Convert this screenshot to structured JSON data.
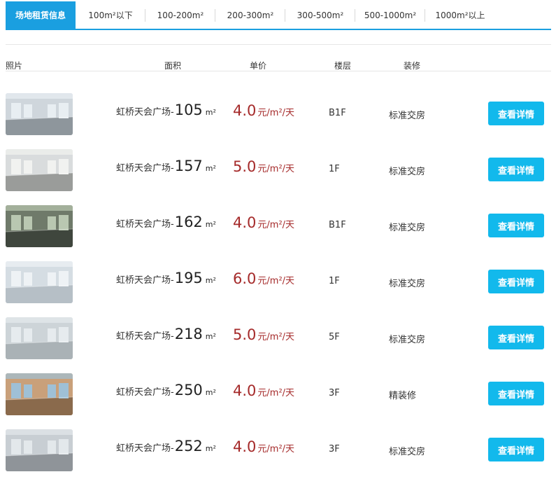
{
  "tabs": [
    {
      "label": "场地租赁信息",
      "active": true
    },
    {
      "label": "100m²以下",
      "active": false
    },
    {
      "label": "100-200m²",
      "active": false
    },
    {
      "label": "200-300m²",
      "active": false
    },
    {
      "label": "300-500m²",
      "active": false
    },
    {
      "label": "500-1000m²",
      "active": false
    },
    {
      "label": "1000m²以上",
      "active": false
    }
  ],
  "table_headers": {
    "photo": "照片",
    "area": "面积",
    "price": "单价",
    "floor": "楼层",
    "decoration": "装修"
  },
  "colors": {
    "accent": "#1a9fe0",
    "button": "#12b9ec",
    "price": "#a52a2a"
  },
  "listings": [
    {
      "location": "虹桥天会广场-",
      "area": "105",
      "area_unit": "m²",
      "price": "4.0",
      "price_unit": "元/m²/天",
      "floor": "B1F",
      "decoration": "标准交房",
      "button": "查看详情"
    },
    {
      "location": "虹桥天会广场-",
      "area": "157",
      "area_unit": "m²",
      "price": "5.0",
      "price_unit": "元/m²/天",
      "floor": "1F",
      "decoration": "标准交房",
      "button": "查看详情"
    },
    {
      "location": "虹桥天会广场-",
      "area": "162",
      "area_unit": "m²",
      "price": "4.0",
      "price_unit": "元/m²/天",
      "floor": "B1F",
      "decoration": "标准交房",
      "button": "查看详情"
    },
    {
      "location": "虹桥天会广场-",
      "area": "195",
      "area_unit": "m²",
      "price": "6.0",
      "price_unit": "元/m²/天",
      "floor": "1F",
      "decoration": "标准交房",
      "button": "查看详情"
    },
    {
      "location": "虹桥天会广场-",
      "area": "218",
      "area_unit": "m²",
      "price": "5.0",
      "price_unit": "元/m²/天",
      "floor": "5F",
      "decoration": "标准交房",
      "button": "查看详情"
    },
    {
      "location": "虹桥天会广场-",
      "area": "250",
      "area_unit": "m²",
      "price": "4.0",
      "price_unit": "元/m²/天",
      "floor": "3F",
      "decoration": "精装修",
      "button": "查看详情"
    },
    {
      "location": "虹桥天会广场-",
      "area": "252",
      "area_unit": "m²",
      "price": "4.0",
      "price_unit": "元/m²/天",
      "floor": "3F",
      "decoration": "标准交房",
      "button": "查看详情"
    }
  ]
}
